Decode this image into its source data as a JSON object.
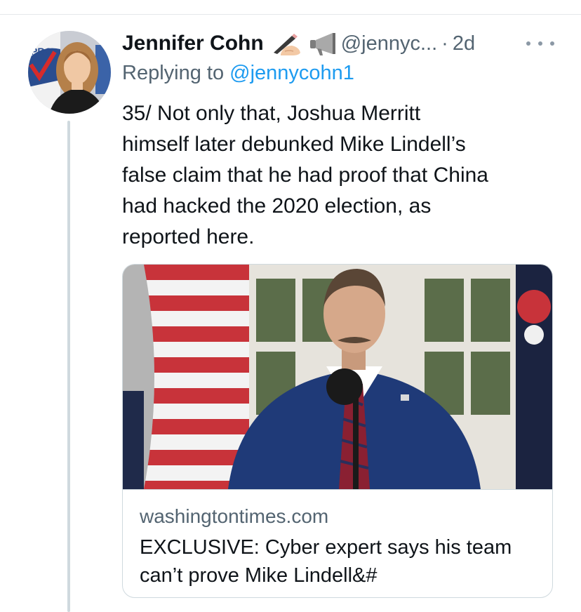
{
  "tweet": {
    "author": {
      "display_name": "Jennifer Cohn",
      "handle": "@jennyc...",
      "emojis": [
        "writing-hand-icon",
        "megaphone-icon"
      ]
    },
    "separator": "·",
    "time": "2d",
    "replying_to_label": "Replying to",
    "replying_to_handle": "@jennycohn1",
    "text_lines": [
      "35/ Not only that, Joshua Merritt",
      "himself later debunked Mike Lindell’s",
      "false claim that he had proof that China",
      "had hacked the 2020 election, as",
      "reported here."
    ],
    "avatar_sign_text": "PRO",
    "link_card": {
      "domain": "washingtontimes.com",
      "title": "EXCLUSIVE: Cyber expert says his team can’t prove Mike Lindell&#"
    }
  },
  "colors": {
    "text": "#0f1419",
    "secondary": "#536471",
    "link": "#1d9bf0",
    "border": "#cfd9de",
    "thread_line": "#cfd9de"
  }
}
